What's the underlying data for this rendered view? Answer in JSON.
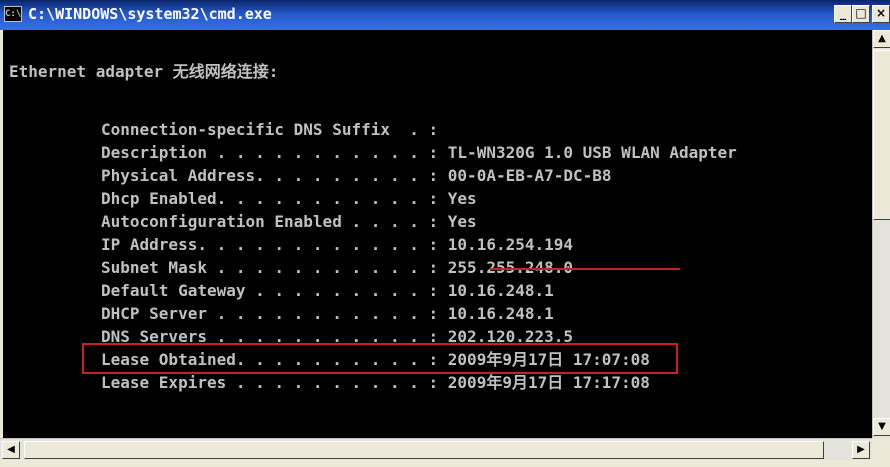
{
  "window": {
    "title": "C:\\WINDOWS\\system32\\cmd.exe",
    "icon_glyph": "C:\\",
    "controls": {
      "minimize": "_",
      "maximize": "□",
      "close": "×"
    }
  },
  "console": {
    "heading": "Ethernet adapter 无线网络连接:",
    "entries": [
      {
        "label": "Connection-specific DNS Suffix  . :",
        "value": ""
      },
      {
        "label": "Description . . . . . . . . . . . :",
        "value": " TL-WN320G 1.0 USB WLAN Adapter"
      },
      {
        "label": "Physical Address. . . . . . . . . :",
        "value": " 00-0A-EB-A7-DC-B8"
      },
      {
        "label": "Dhcp Enabled. . . . . . . . . . . :",
        "value": " Yes"
      },
      {
        "label": "Autoconfiguration Enabled . . . . :",
        "value": " Yes"
      },
      {
        "label": "IP Address. . . . . . . . . . . . :",
        "value": " 10.16.254.194"
      },
      {
        "label": "Subnet Mask . . . . . . . . . . . :",
        "value": " 255.255.248.0"
      },
      {
        "label": "Default Gateway . . . . . . . . . :",
        "value": " 10.16.248.1"
      },
      {
        "label": "DHCP Server . . . . . . . . . . . :",
        "value": " 10.16.248.1"
      },
      {
        "label": "DNS Servers . . . . . . . . . . . :",
        "value": " 202.120.223.5"
      },
      {
        "label": "Lease Obtained. . . . . . . . . . :",
        "value": " 2009年9月17日 17:07:08"
      },
      {
        "label": "Lease Expires . . . . . . . . . . :",
        "value": " 2009年9月17日 17:17:08"
      }
    ]
  },
  "colors": {
    "console_bg": "#000000",
    "console_text": "#c0c0c0",
    "annotation": "#cc1f1f"
  },
  "icons": [
    "console-app-icon",
    "scroll-up-icon",
    "scroll-down-icon",
    "scroll-left-icon",
    "scroll-right-icon"
  ]
}
